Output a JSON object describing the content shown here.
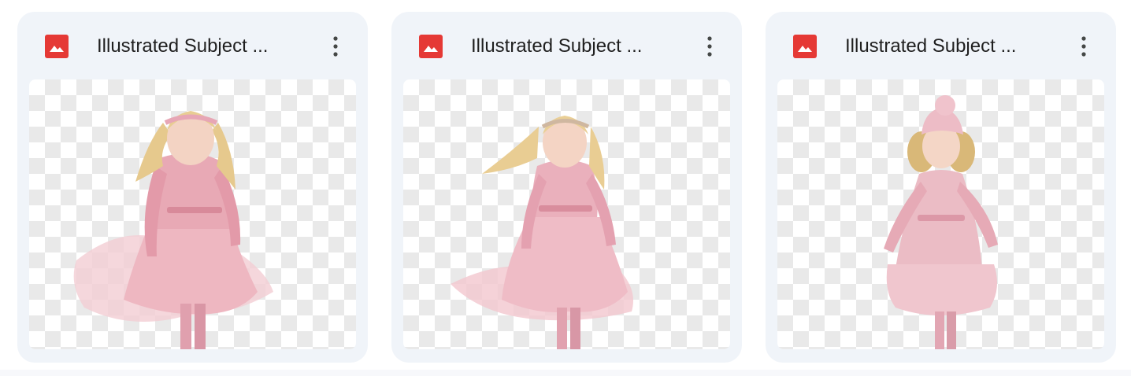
{
  "files": [
    {
      "title": "Illustrated Subject ...",
      "type_icon": "image-file-icon",
      "menu_icon": "more-vert-icon",
      "thumbnail": "watercolor girl in pink coat with floral crown, flowing blonde hair"
    },
    {
      "title": "Illustrated Subject ...",
      "type_icon": "image-file-icon",
      "menu_icon": "more-vert-icon",
      "thumbnail": "watercolor girl in pink fluffy dress walking, floral crown"
    },
    {
      "title": "Illustrated Subject ...",
      "type_icon": "image-file-icon",
      "menu_icon": "more-vert-icon",
      "thumbnail": "watercolor girl with curly hair in pink knit hat and pink coat"
    }
  ],
  "colors": {
    "card_bg": "#f0f4f9",
    "image_icon_red": "#e53935",
    "title_text": "#1f1f1f"
  }
}
